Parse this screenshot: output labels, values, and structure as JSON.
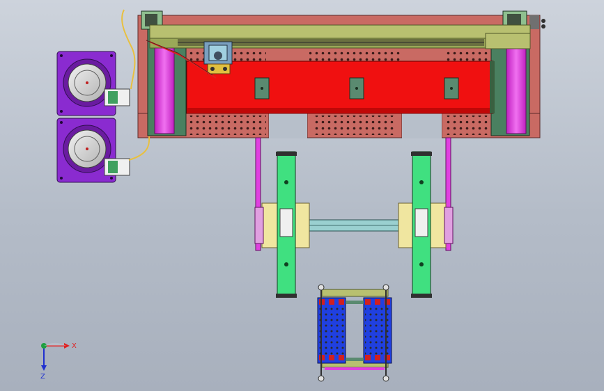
{
  "axes": {
    "x_label": "X",
    "z_label": "Z",
    "x_color": "#e02020",
    "z_color": "#2030d0",
    "y_color": "#20a040"
  },
  "colors": {
    "background_top": "#cdd3dc",
    "background_bottom": "#a8b0bd",
    "base_plate": "#c96a63",
    "red_carriage": "#f01010",
    "magenta_column": "#e040e0",
    "olive_beam": "#b8c070",
    "green_arm": "#40e080",
    "cream_block": "#f0e6a0",
    "purple_motor": "#8a2bd0",
    "blue_gripper": "#2040e0",
    "teal_plate": "#5a8a70",
    "cable": "#e8c040"
  }
}
